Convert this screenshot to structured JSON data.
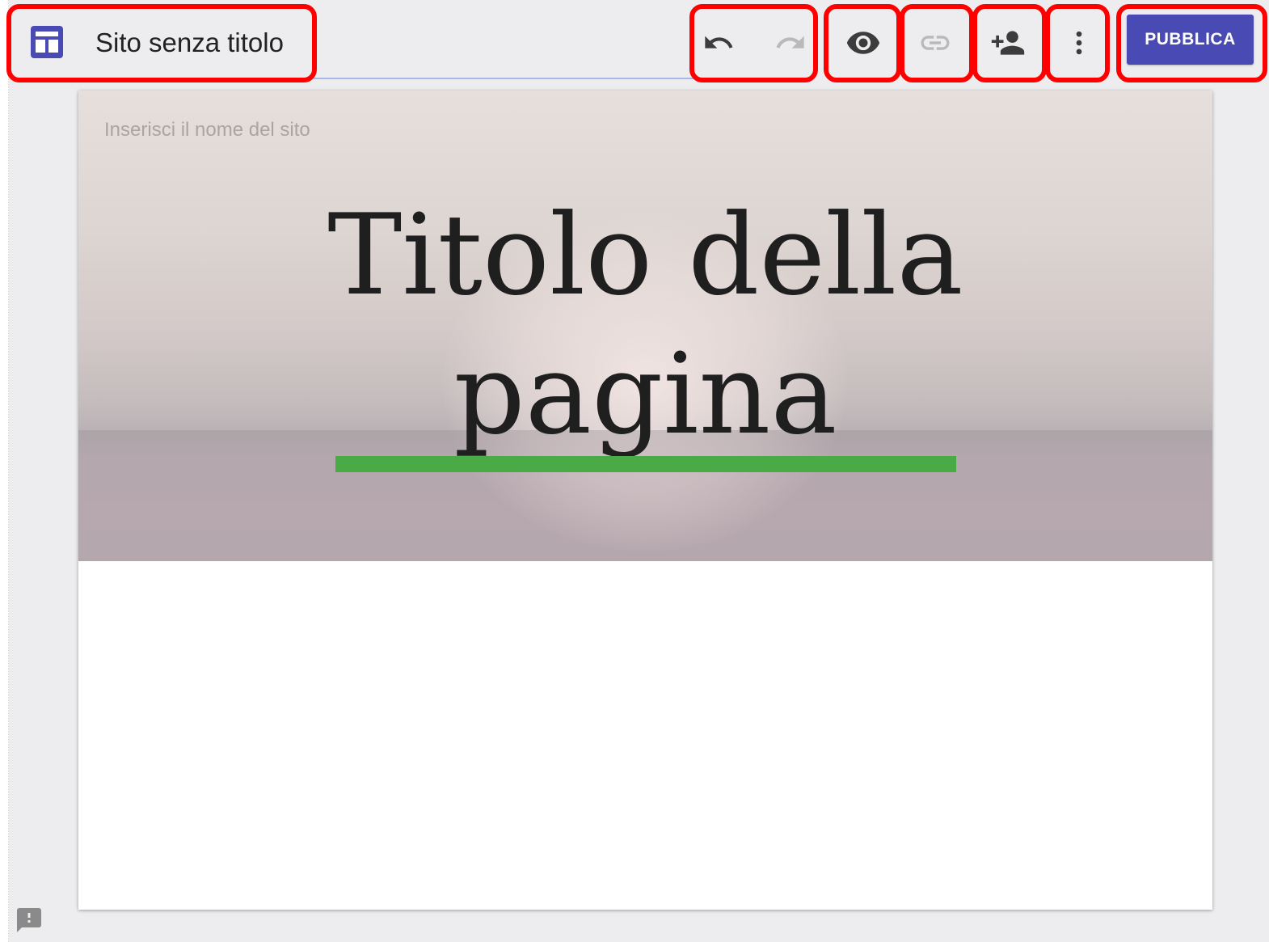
{
  "header": {
    "site_title": "Sito senza titolo",
    "publish_label": "PUBBLICA",
    "icons": {
      "logo": "sites-layout-icon",
      "undo": "undo-icon",
      "redo": "redo-icon",
      "preview": "eye-icon",
      "copy_link": "link-icon",
      "share": "add-person-icon",
      "more": "more-vert-icon"
    }
  },
  "page": {
    "site_name_placeholder": "Inserisci il nome del sito",
    "title_line1": "Titolo della",
    "title_line2": "pagina"
  },
  "feedback": {
    "icon": "feedback-icon"
  },
  "colors": {
    "accent": "#4a4ab4",
    "underline": "#4aab46",
    "highlight": "#ff0000"
  }
}
